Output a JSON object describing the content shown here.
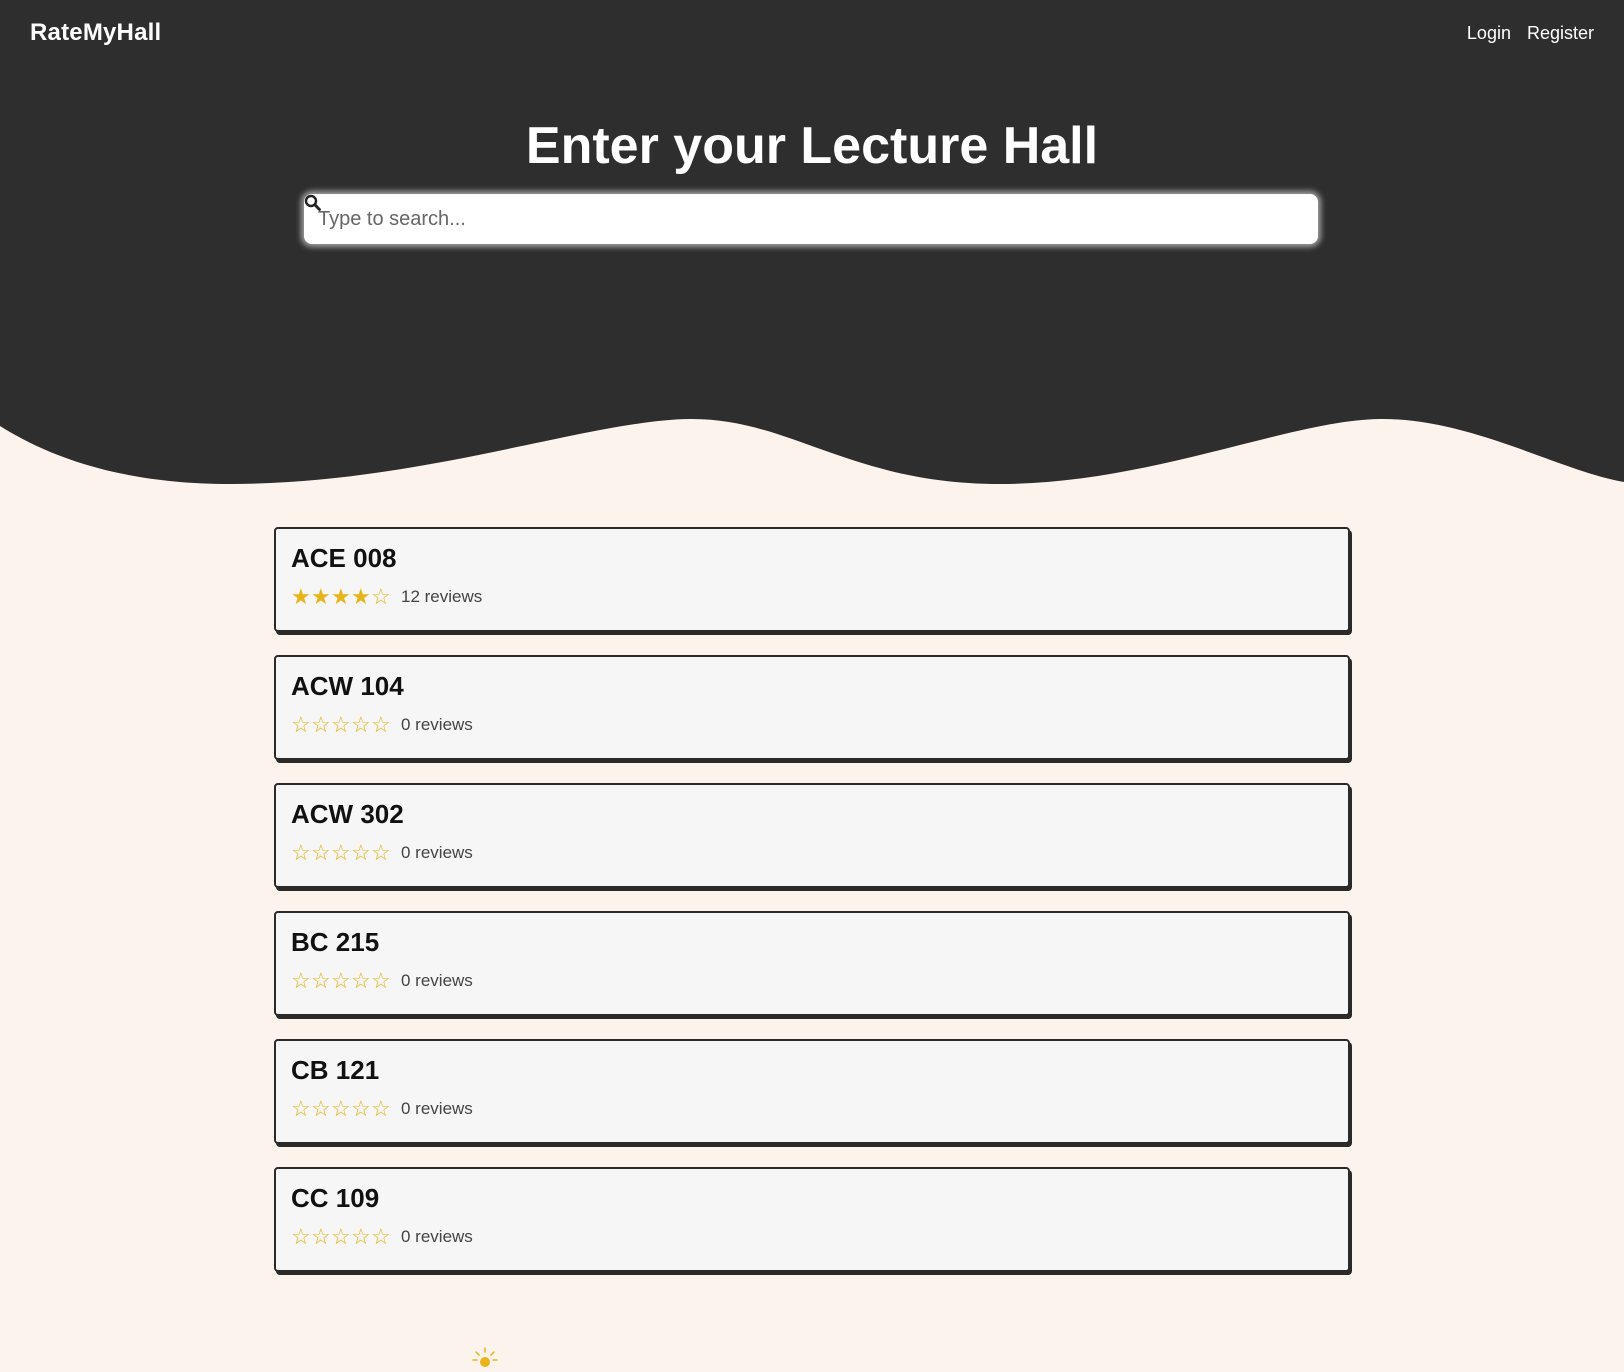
{
  "navbar": {
    "brand": "RateMyHall",
    "login_label": "Login",
    "register_label": "Register"
  },
  "hero": {
    "title": "Enter your Lecture Hall",
    "search_placeholder": "Type to search...",
    "search_icon": "search-icon"
  },
  "colors": {
    "dark": "#2e2e2e",
    "background": "#fcf4ec",
    "card": "#f6f6f6",
    "star": "#e8b419"
  },
  "halls": [
    {
      "name": "ACE 008",
      "rating": 4,
      "reviews": "12 reviews"
    },
    {
      "name": "ACW 104",
      "rating": 0,
      "reviews": "0 reviews"
    },
    {
      "name": "ACW 302",
      "rating": 0,
      "reviews": "0 reviews"
    },
    {
      "name": "BC 215",
      "rating": 0,
      "reviews": "0 reviews"
    },
    {
      "name": "CB 121",
      "rating": 0,
      "reviews": "0 reviews"
    },
    {
      "name": "CC 109",
      "rating": 0,
      "reviews": "0 reviews"
    }
  ],
  "footer_icon": "lightbulb-icon"
}
